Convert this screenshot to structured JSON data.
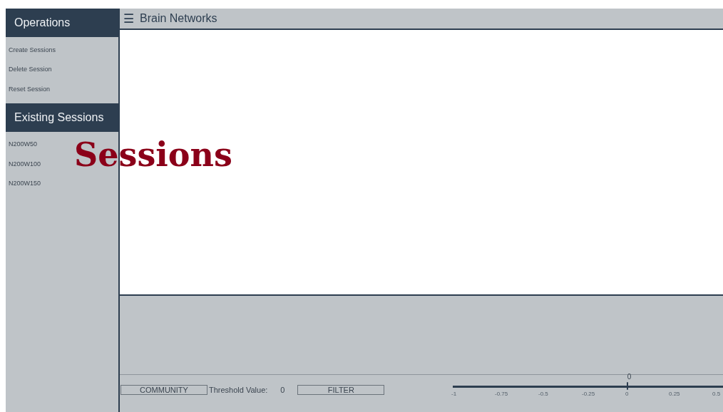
{
  "sidebar": {
    "sections": [
      {
        "title": "Operations",
        "items": [
          {
            "label": "Create Sessions"
          },
          {
            "label": "Delete Session"
          },
          {
            "label": "Reset Session"
          }
        ]
      },
      {
        "title": "Existing Sessions",
        "items": [
          {
            "label": "N200W50"
          },
          {
            "label": "N200W100"
          },
          {
            "label": "N200W150"
          }
        ]
      }
    ]
  },
  "header": {
    "icon": "☰",
    "title": "Brain Networks"
  },
  "overlay_title": "Sessions",
  "controls": {
    "community_button": "COMMUNITY",
    "threshold_label": "Threshold Value:",
    "threshold_value": "0",
    "filter_button": "FILTER"
  },
  "slider": {
    "level": 0.646,
    "thumb_label": "0",
    "ticks": [
      "-1",
      "-0.75",
      "-0.5",
      "-0.25",
      "0",
      "0.25",
      "0.5"
    ]
  }
}
